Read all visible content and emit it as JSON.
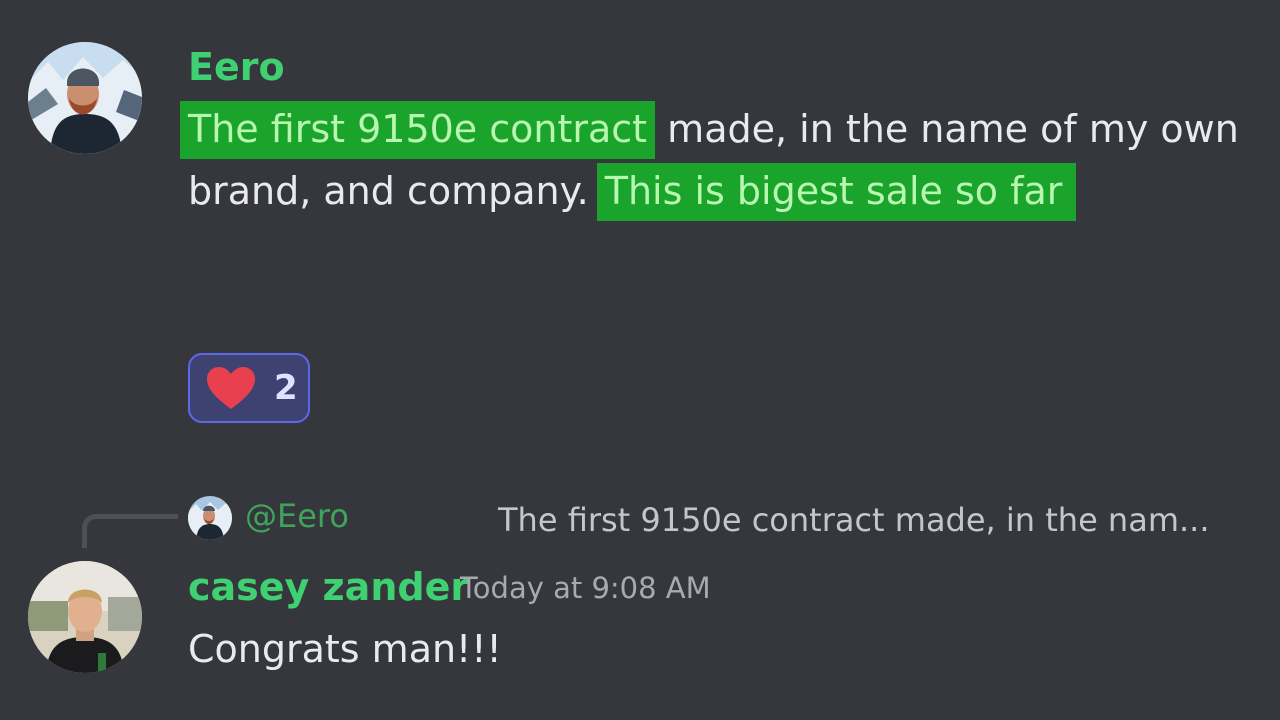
{
  "message_1": {
    "author": "Eero",
    "highlight_1": "The first 9150e  contract",
    "line_1_rest": " made, in the name of my own",
    "line_2_text": "brand, and company.",
    "highlight_2": "This is bigest sale so far",
    "reaction": {
      "emoji": "heart-icon",
      "count": "2"
    }
  },
  "message_2": {
    "reply": {
      "mention": "@Eero",
      "preview": "The first 9150e  contract made, in the nam..."
    },
    "author": "casey zander",
    "timestamp": "Today at 9:08 AM",
    "text": "Congrats man!!!"
  },
  "colors": {
    "background": "#36373d",
    "username": "#3fd071",
    "highlight": "#1ba42b",
    "reaction_border": "#5c68e8",
    "heart": "#e8404f"
  }
}
